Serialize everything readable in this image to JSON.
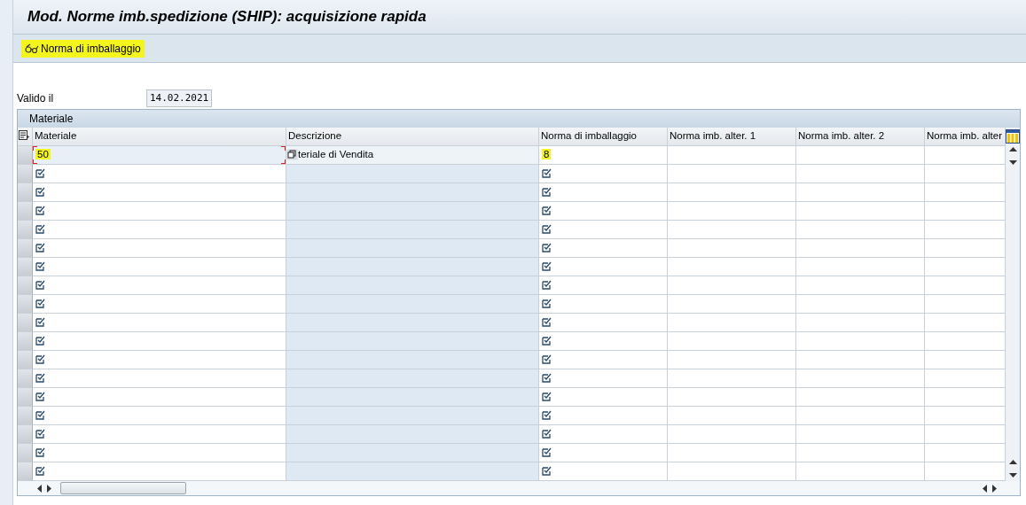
{
  "window": {
    "title": "Mod. Norme imb.spedizione (SHIP): acquisizione rapida"
  },
  "toolbar": {
    "buttons": [
      {
        "label": "Norma di imballaggio",
        "highlighted": true
      }
    ]
  },
  "valid_date": {
    "label": "Valido il",
    "value": "14.02.2021"
  },
  "table": {
    "title": "Materiale",
    "columns": [
      "Materiale",
      "Descrizione",
      "Norma di imballaggio",
      "Norma imb. alter. 1",
      "Norma imb. alter. 2",
      "Norma imb. alter"
    ],
    "rows": [
      {
        "kind": "filled",
        "materiale": "50",
        "descrizione": "teriale di Vendita",
        "norma": "8",
        "highlighted": true,
        "focused": true
      },
      {
        "kind": "empty"
      },
      {
        "kind": "empty"
      },
      {
        "kind": "empty"
      },
      {
        "kind": "empty"
      },
      {
        "kind": "empty"
      },
      {
        "kind": "empty"
      },
      {
        "kind": "empty"
      },
      {
        "kind": "empty"
      },
      {
        "kind": "empty"
      },
      {
        "kind": "empty"
      },
      {
        "kind": "empty"
      },
      {
        "kind": "empty"
      },
      {
        "kind": "empty"
      },
      {
        "kind": "empty"
      },
      {
        "kind": "empty"
      },
      {
        "kind": "empty"
      },
      {
        "kind": "empty"
      }
    ]
  }
}
